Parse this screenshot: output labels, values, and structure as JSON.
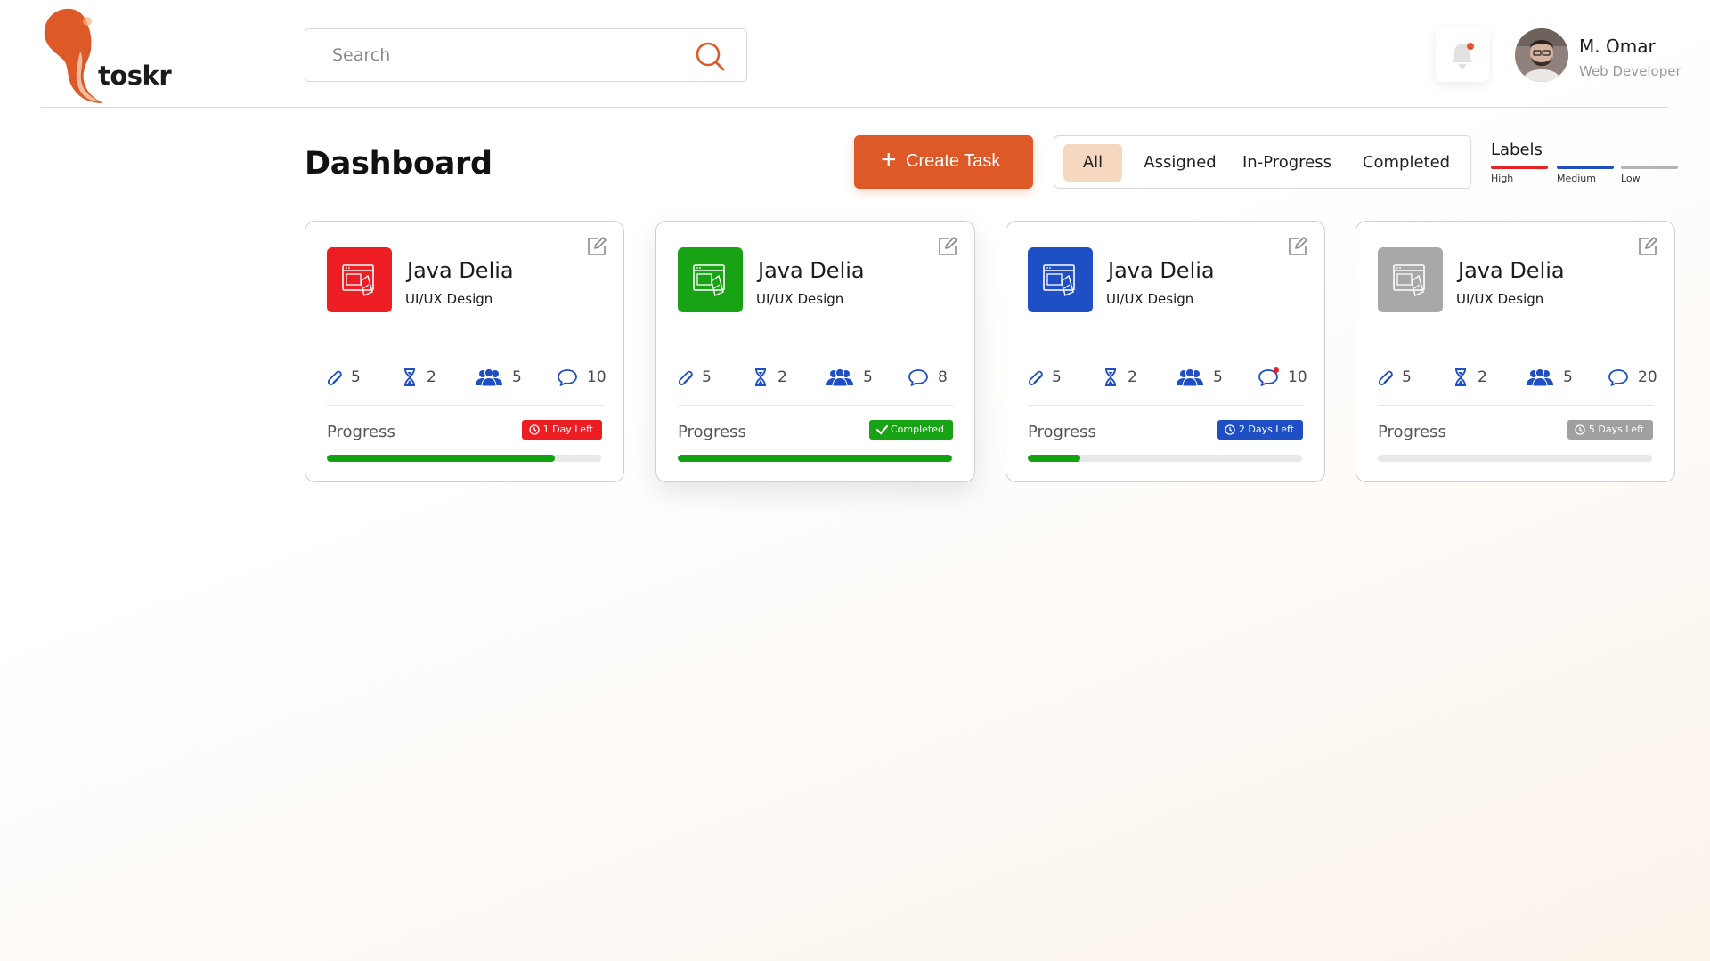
{
  "header": {
    "logo_text": "toskr",
    "search": {
      "placeholder": "Search",
      "value": ""
    },
    "notifications": {
      "icon": "bell-icon",
      "has_unread": true,
      "unread_color": "#e5532b"
    },
    "user": {
      "name": "M. Omar",
      "role": "Web Developer"
    }
  },
  "toolbar": {
    "page_title": "Dashboard",
    "create_button": "Create Task",
    "filters": [
      "All",
      "Assigned",
      "In-Progress",
      "Completed"
    ],
    "active_filter": "All",
    "labels": {
      "title": "Labels",
      "items": [
        {
          "name": "High",
          "color": "#e42326"
        },
        {
          "name": "Medium",
          "color": "#1f4fc4"
        },
        {
          "name": "Low",
          "color": "#b4b4b4"
        }
      ]
    }
  },
  "colors": {
    "accent": "#dd5a28",
    "red": "#ed1d24",
    "green": "#17a313",
    "blue": "#1f4fc4",
    "gray": "#a8a8a8",
    "progress_green": "#10a30f"
  },
  "cards": [
    {
      "title": "Java Delia",
      "subtitle": "UI/UX Design",
      "icon_color": "#ed1d24",
      "attachments": "5",
      "time": "2",
      "members": "5",
      "comments": "10",
      "comments_unread": false,
      "progress_label": "Progress",
      "status": "1 Day Left",
      "status_color": "#ed1d24",
      "status_icon": "clock-icon",
      "progress": 0.83
    },
    {
      "title": "Java Delia",
      "subtitle": "UI/UX Design",
      "icon_color": "#17a313",
      "attachments": "5",
      "time": "2",
      "members": "5",
      "comments": "8",
      "comments_unread": false,
      "progress_label": "Progress",
      "status": "Completed",
      "status_color": "#17a313",
      "status_icon": "check-icon",
      "progress": 1.0
    },
    {
      "title": "Java Delia",
      "subtitle": "UI/UX Design",
      "icon_color": "#1f4fc4",
      "attachments": "5",
      "time": "2",
      "members": "5",
      "comments": "10",
      "comments_unread": true,
      "progress_label": "Progress",
      "status": "2 Days Left",
      "status_color": "#1f4fc4",
      "status_icon": "clock-icon",
      "progress": 0.19
    },
    {
      "title": "Java Delia",
      "subtitle": "UI/UX Design",
      "icon_color": "#a8a8a8",
      "attachments": "5",
      "time": "2",
      "members": "5",
      "comments": "20",
      "comments_unread": false,
      "progress_label": "Progress",
      "status": "5 Days Left",
      "status_color": "#a0a0a0",
      "status_icon": "clock-icon",
      "progress": 0.0
    }
  ]
}
